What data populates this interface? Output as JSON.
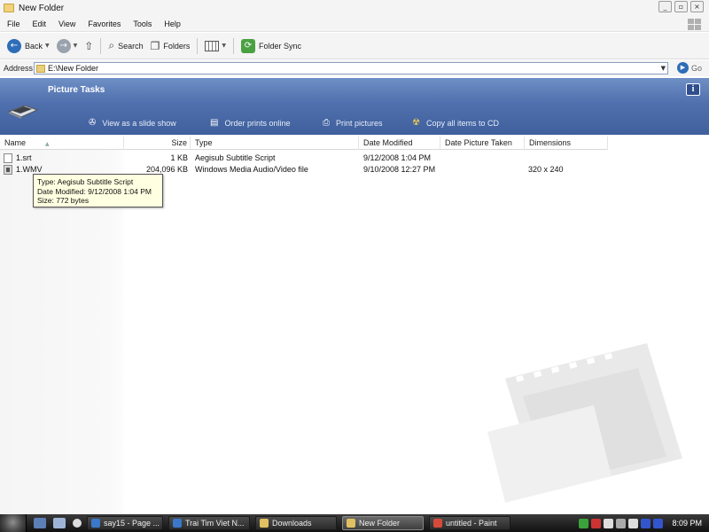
{
  "window": {
    "title": "New Folder",
    "controls": {
      "minimize": "_",
      "maximize": "▫",
      "close": "×"
    }
  },
  "menu": [
    "File",
    "Edit",
    "View",
    "Favorites",
    "Tools",
    "Help"
  ],
  "toolbar": {
    "back": "Back",
    "search": "Search",
    "folders": "Folders",
    "folder_sync": "Folder Sync",
    "icons": {
      "back": "back-arrow-icon",
      "forward": "forward-arrow-icon",
      "up": "up-folder-icon",
      "search": "magnifier-icon",
      "folders": "folders-icon",
      "views": "views-grid-icon",
      "sync": "folder-sync-icon"
    }
  },
  "address": {
    "label": "Address",
    "value": "E:\\New Folder",
    "go": "Go"
  },
  "picture_tasks": {
    "title": "Picture Tasks",
    "tasks": [
      "View as a slide show",
      "Order prints online",
      "Print pictures",
      "Copy all items to CD"
    ]
  },
  "columns": {
    "name": "Name",
    "size": "Size",
    "type": "Type",
    "date_modified": "Date Modified",
    "date_picture_taken": "Date Picture Taken",
    "dimensions": "Dimensions"
  },
  "files": [
    {
      "name": "1.srt",
      "size": "1 KB",
      "type": "Aegisub Subtitle Script",
      "date_modified": "9/12/2008 1:04 PM",
      "date_picture_taken": "",
      "dimensions": ""
    },
    {
      "name": "1.WMV",
      "size": "204,096 KB",
      "type": "Windows Media Audio/Video file",
      "date_modified": "9/10/2008 12:27 PM",
      "date_picture_taken": "",
      "dimensions": "320 x 240"
    }
  ],
  "tooltip": {
    "type_line": "Type: Aegisub Subtitle Script",
    "date_line": "Date Modified: 9/12/2008 1:04 PM",
    "size_line": "Size: 772 bytes"
  },
  "taskbar": {
    "tasks": [
      {
        "label": "say15 - Page ...",
        "color": "#3a78c9"
      },
      {
        "label": "Trai Tim Viet N...",
        "color": "#3a78c9"
      },
      {
        "label": "Downloads",
        "color": "#e0c060"
      },
      {
        "label": "New Folder",
        "color": "#e0c060",
        "active": true
      },
      {
        "label": "untitled - Paint",
        "color": "#d64a3a"
      }
    ],
    "clock": "8:09 PM",
    "tray_colors": [
      "#3aa23a",
      "#cc3333",
      "#dddddd",
      "#aaaaaa",
      "#dddddd",
      "#3355cc",
      "#3355cc"
    ]
  }
}
